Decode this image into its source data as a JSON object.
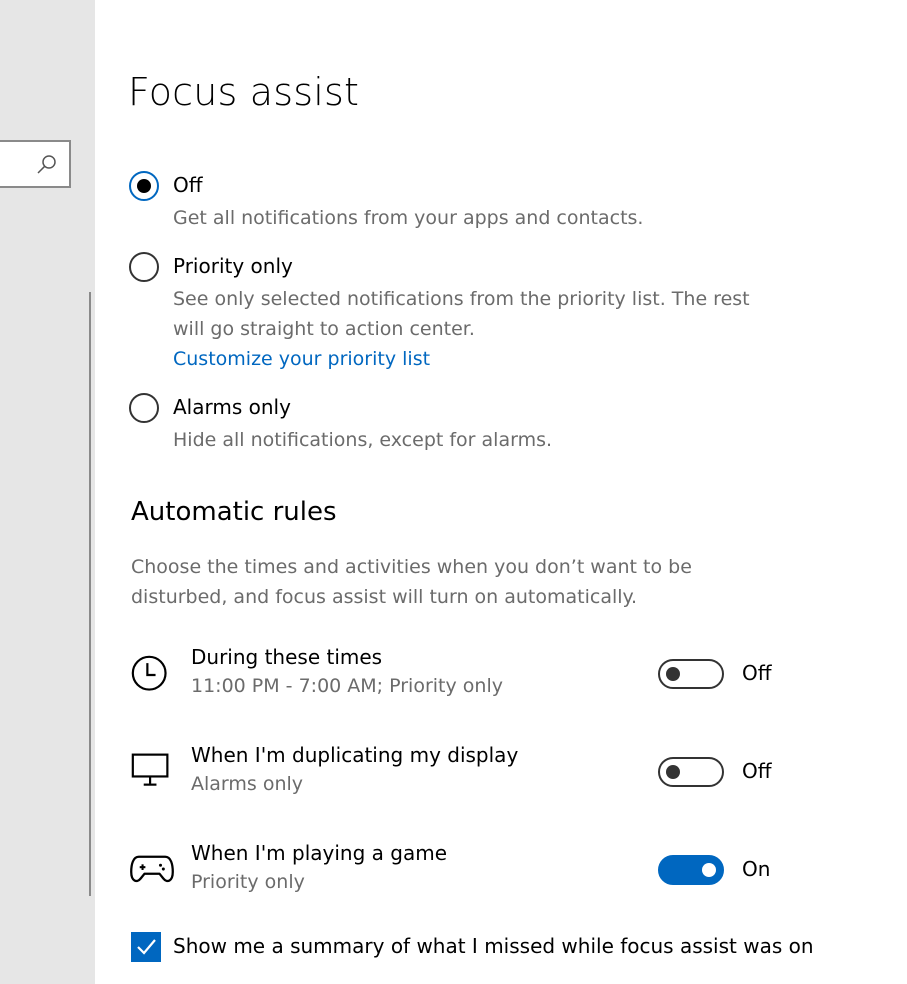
{
  "page": {
    "title": "Focus assist"
  },
  "colors": {
    "accent": "#0067c0",
    "sidebar_bg": "#e6e6e6",
    "secondary_text": "#6b6b6b"
  },
  "modes": [
    {
      "label": "Off",
      "description": "Get all notifications from your apps and contacts.",
      "selected": true
    },
    {
      "label": "Priority only",
      "description": "See only selected notifications from the priority list. The rest will go straight to action center.",
      "link": "Customize your priority list",
      "selected": false
    },
    {
      "label": "Alarms only",
      "description": "Hide all notifications, except for alarms.",
      "selected": false
    }
  ],
  "automatic_rules": {
    "title": "Automatic rules",
    "description": "Choose the times and activities when you don’t want to be disturbed, and focus assist will turn on automatically.",
    "rules": [
      {
        "icon": "clock-icon",
        "title": "During these times",
        "subtitle": "11:00 PM - 7:00 AM; Priority only",
        "toggle_state": "Off",
        "enabled": false
      },
      {
        "icon": "monitor-icon",
        "title": "When I'm duplicating my display",
        "subtitle": "Alarms only",
        "toggle_state": "Off",
        "enabled": false
      },
      {
        "icon": "gamepad-icon",
        "title": "When I'm playing a game",
        "subtitle": "Priority only",
        "toggle_state": "On",
        "enabled": true
      }
    ]
  },
  "summary_checkbox": {
    "label": "Show me a summary of what I missed while focus assist was on",
    "checked": true
  }
}
